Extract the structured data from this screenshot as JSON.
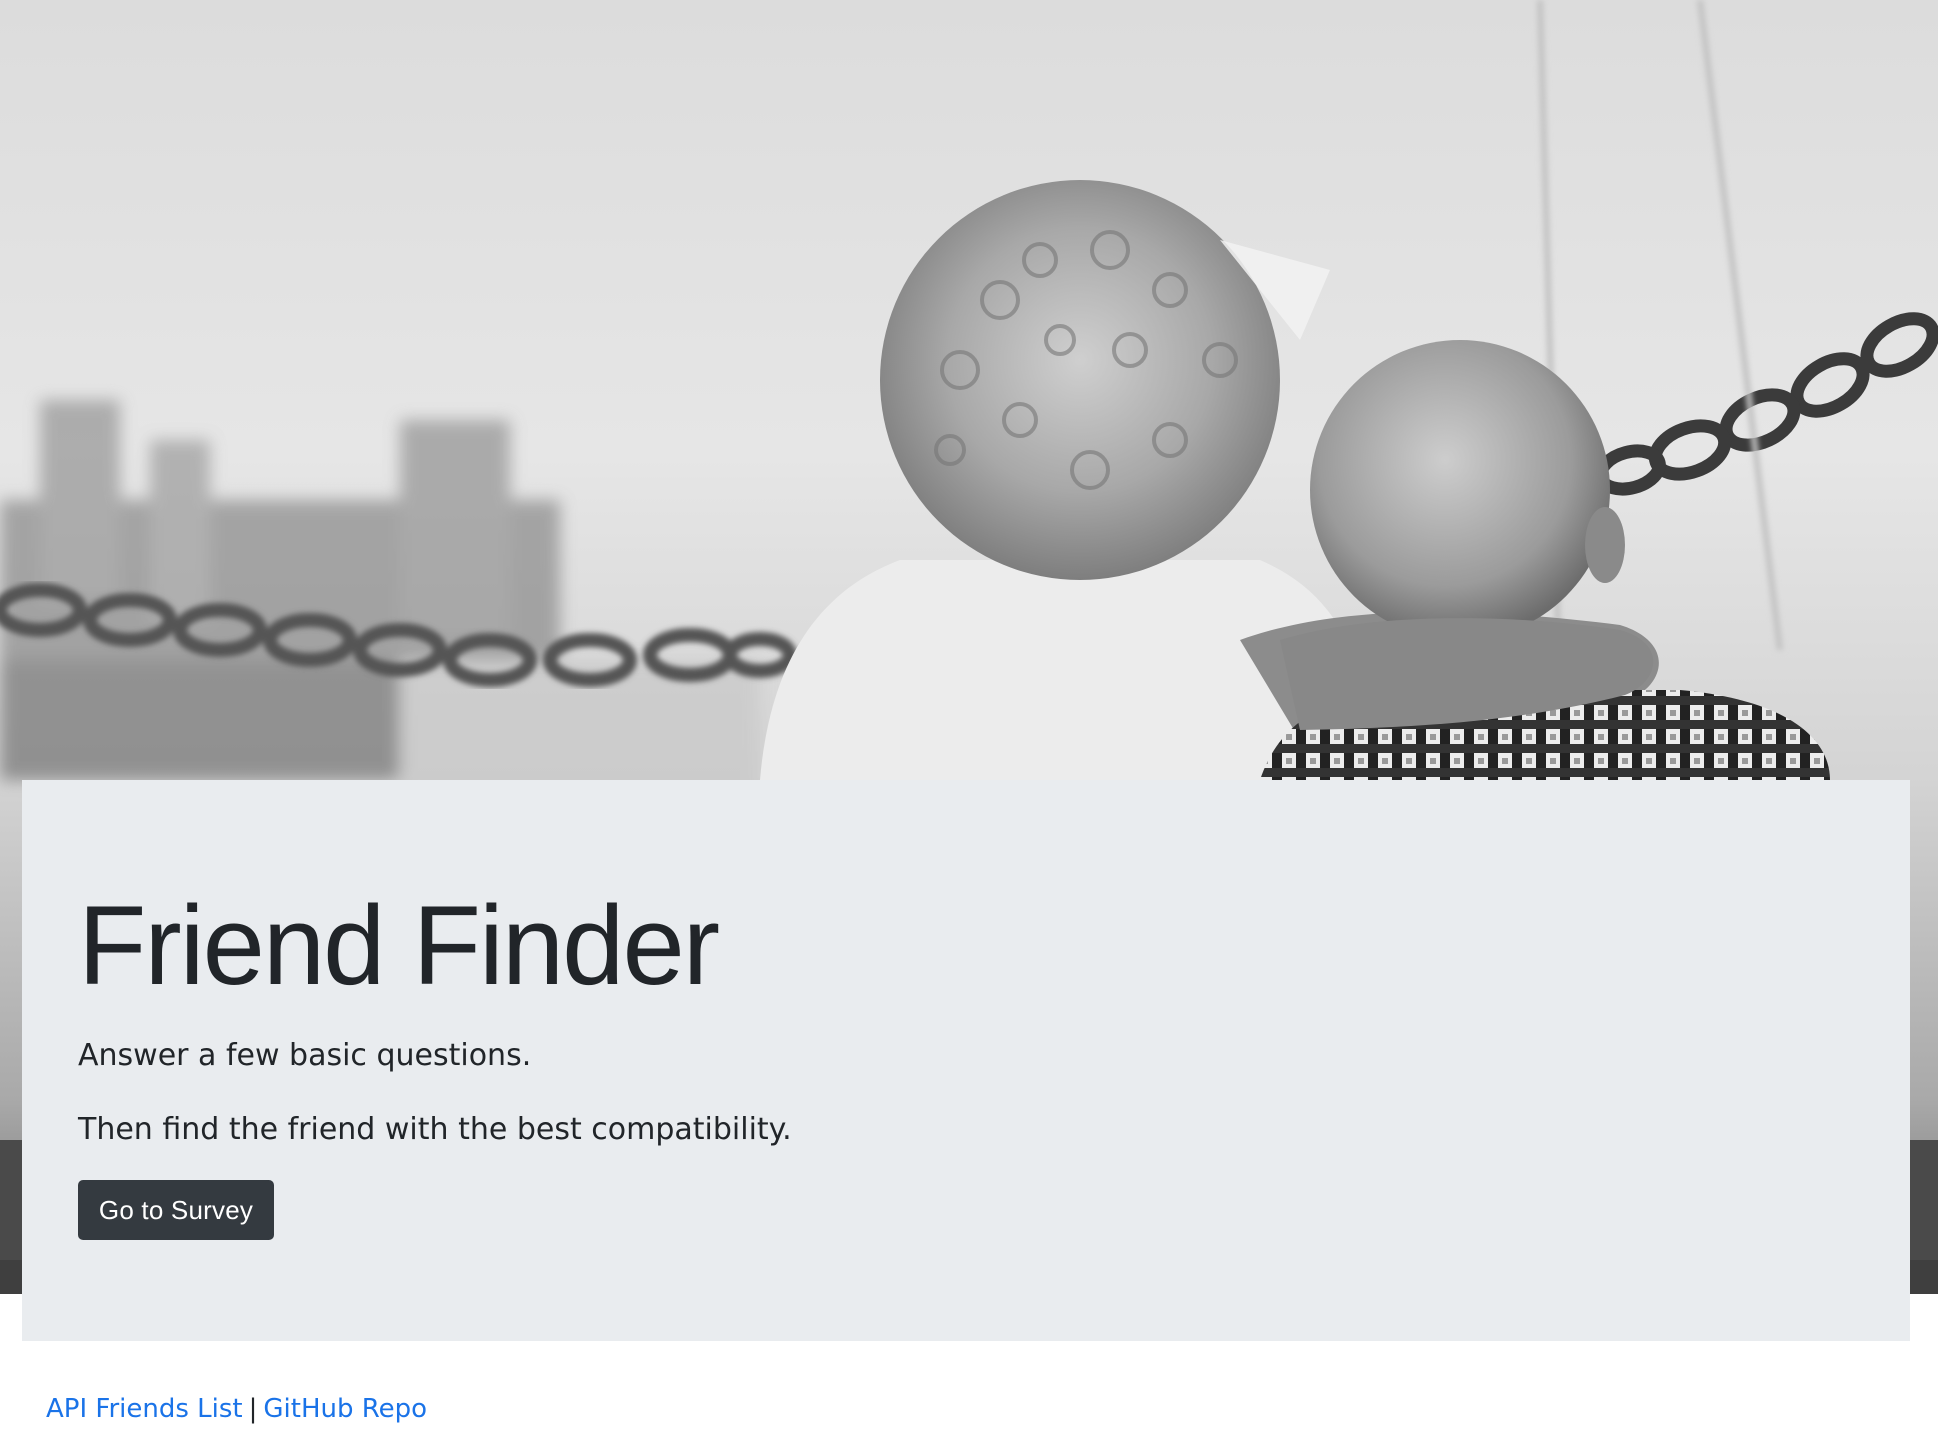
{
  "hero": {
    "image_description_icon": "hero-photo-image"
  },
  "jumbotron": {
    "title": "Friend Finder",
    "line1": "Answer a few basic questions.",
    "line2": "Then find the friend with the best compatibility.",
    "button_label": "Go to Survey"
  },
  "footer": {
    "link1": "API Friends List",
    "separator": "|",
    "link2": "GitHub Repo"
  },
  "colors": {
    "jumbotron_bg": "#e9ecef",
    "button_bg": "#343a40",
    "link": "#1a73e8",
    "text": "#212529"
  }
}
